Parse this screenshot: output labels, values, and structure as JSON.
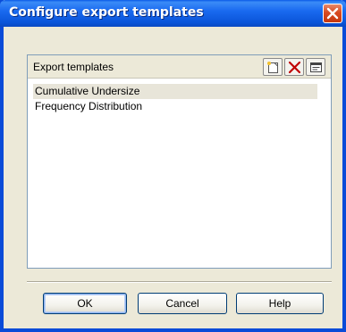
{
  "window": {
    "title": "Configure export templates"
  },
  "templates": {
    "header_label": "Export templates",
    "toolbar": {
      "new_icon": "new-document-icon",
      "delete_icon": "delete-x-icon",
      "properties_icon": "properties-icon"
    },
    "items": [
      {
        "label": "Cumulative Undersize",
        "selected": true
      },
      {
        "label": "Frequency Distribution",
        "selected": false
      }
    ]
  },
  "buttons": {
    "ok": "OK",
    "cancel": "Cancel",
    "help": "Help"
  },
  "colors": {
    "titlebar": "#0a54d8",
    "close_button": "#d84a22",
    "dialog_background": "#ece9d8",
    "selection": "#e8e5d9",
    "list_border": "#7f9db9"
  }
}
